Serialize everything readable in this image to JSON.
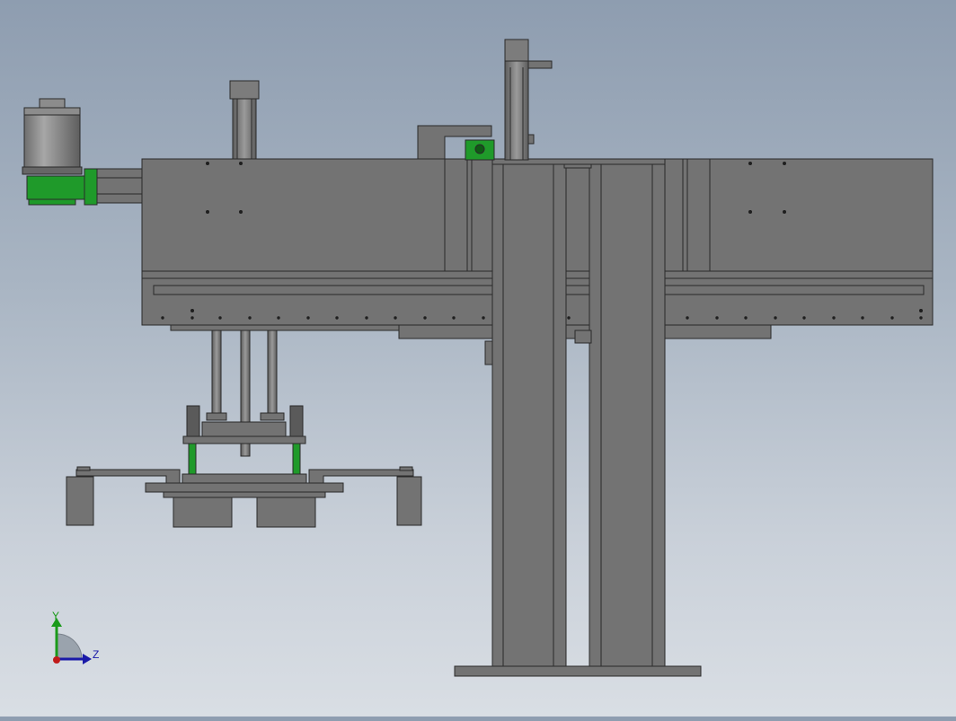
{
  "viewport": {
    "background_top": "#8e9db0",
    "background_bottom": "#d9dee4",
    "part_color": "#737373",
    "edge_color": "#2a2a2a",
    "accent_green": "#1f9a2a"
  },
  "triad": {
    "y_label": "Y",
    "z_label": "Z",
    "y_color": "#1a9a1a",
    "z_color": "#1a1aa8",
    "x_color": "#c01a1a"
  }
}
